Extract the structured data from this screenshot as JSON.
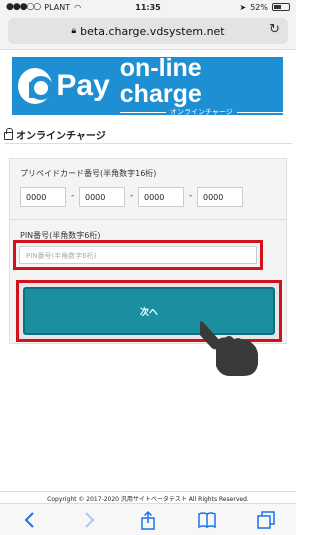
{
  "status_bar": {
    "carrier": "PLANT",
    "time": "11:35",
    "battery_percent": "52%",
    "battery_level": 0.52
  },
  "browser": {
    "url": "beta.charge.vdsystem.net"
  },
  "banner": {
    "pay_text": "Pay",
    "charge_text": "on-line charge",
    "subtitle": "オンラインチャージ"
  },
  "page": {
    "section_title": "オンラインチャージ"
  },
  "form": {
    "card_label": "プリペイドカード番号(半角数字16桁)",
    "card_fields": [
      "0000",
      "0000",
      "0000",
      "0000"
    ],
    "pin_label": "PIN番号(半角数字6桁)",
    "pin_placeholder": "PIN番号(半角数字6桁)",
    "submit_label": "次へ"
  },
  "footer": {
    "copyright": "Copyright © 2017-2020 汎用サイトベータテスト All Rights Reserved."
  },
  "icons": {
    "back": "back-arrow-icon",
    "forward": "forward-arrow-icon",
    "share": "share-icon",
    "bookmarks": "bookmarks-icon",
    "tabs": "tabs-icon"
  },
  "colors": {
    "brand_blue": "#1f8fd3",
    "button_teal": "#1b8fa0",
    "highlight_red": "#d3101e"
  }
}
